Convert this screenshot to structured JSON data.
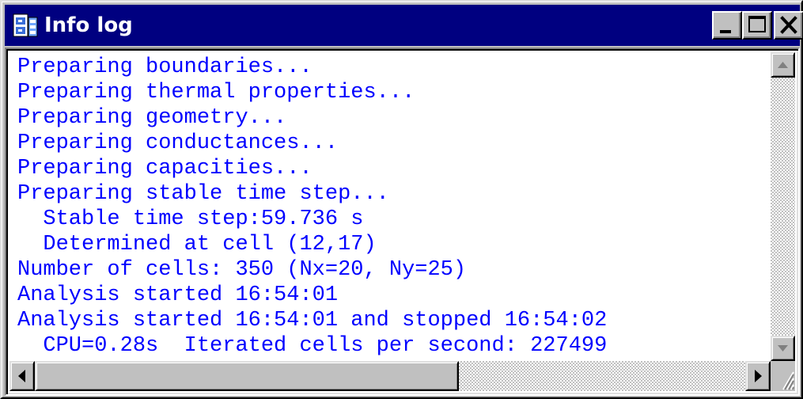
{
  "window": {
    "title": "Info log",
    "icon": "app-icon"
  },
  "title_buttons": {
    "minimize": "minimize-icon",
    "maximize": "maximize-icon",
    "close": "close-icon"
  },
  "log": {
    "lines": [
      "Preparing boundaries...",
      "Preparing thermal properties...",
      "Preparing geometry...",
      "Preparing conductances...",
      "Preparing capacities...",
      "Preparing stable time step...",
      "  Stable time step:59.736 s",
      "  Determined at cell (12,17)",
      "Number of cells: 350 (Nx=20, Ny=25)",
      "Analysis started 16:54:01",
      "Analysis started 16:54:01 and stopped 16:54:02",
      "  CPU=0.28s  Iterated cells per second: 227499"
    ],
    "text_color": "#0000ff"
  },
  "colors": {
    "titlebar": "#000080",
    "face": "#c0c0c0",
    "background": "#ffffff"
  }
}
